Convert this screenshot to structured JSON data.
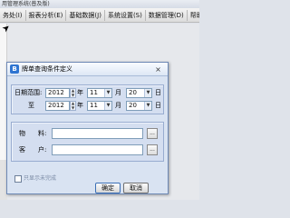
{
  "app": {
    "title_fragment": "用管理系统(普及版)",
    "menu": [
      "务处(I)",
      "报表分析(E)",
      "基础数据(J)",
      "系统设置(S)",
      "数据管理(D)",
      "帮助"
    ]
  },
  "dialog": {
    "title": "牌单查询条件定义",
    "icon_letter": "B",
    "close_glyph": "×",
    "date": {
      "range_label": "日期范围:",
      "to_label": "至",
      "year_unit": "年",
      "month_unit": "月",
      "day_unit": "日",
      "from": {
        "year": "2012",
        "month": "11",
        "day": "20"
      },
      "to": {
        "year": "2012",
        "month": "11",
        "day": "20"
      }
    },
    "fields": {
      "material_label": "物　　料:",
      "customer_label": "客　　户:",
      "material_value": "",
      "customer_value": "",
      "browse_glyph": "..."
    },
    "checkbox_label": "只显示未完成",
    "ok_label": "确定",
    "cancel_label": "取消"
  },
  "colors": {
    "dialog_bg": "#d9e3f2",
    "panel_bg": "#d4def0",
    "accent": "#2e74d1"
  }
}
